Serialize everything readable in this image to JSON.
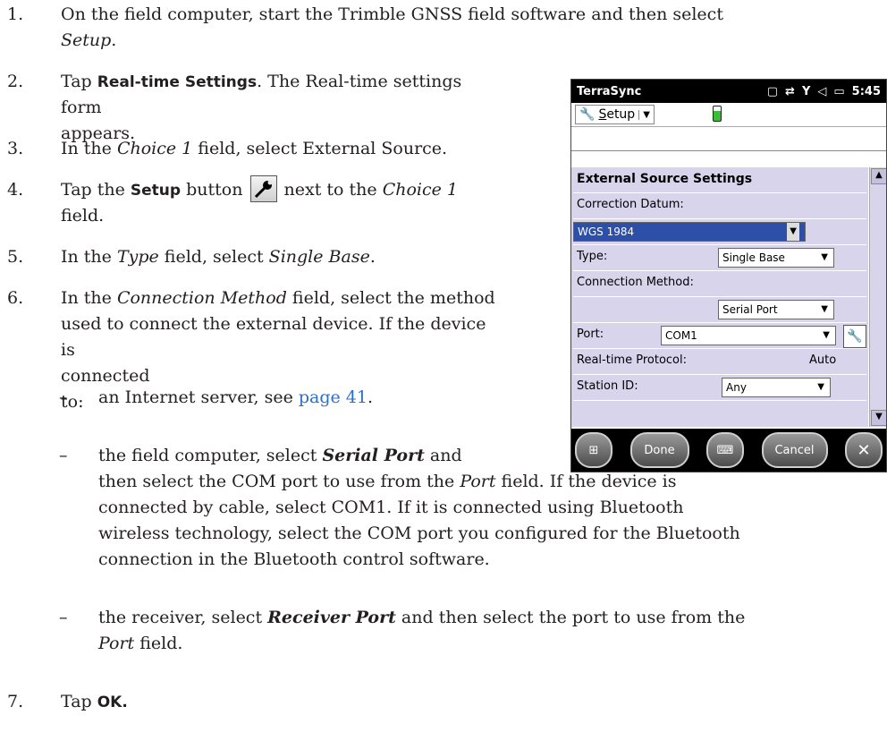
{
  "steps": [
    {
      "num": "1.",
      "pre": "On the field computer, start the Trimble GNSS field software and then select ",
      "em": "Setup",
      "post": "."
    },
    {
      "num": "2.",
      "pre": "Tap ",
      "ui": "Real-time Settings",
      "post": ". The Real-time settings",
      "line2": "form appears."
    },
    {
      "num": "3.",
      "pre": "In the ",
      "em": "Choice 1",
      "post": " field, select External Source."
    },
    {
      "num": "4.",
      "pre": "Tap the ",
      "ui": "Setup",
      "mid": " button ",
      "post": " next to the ",
      "em": "Choice 1",
      "line2": "field."
    },
    {
      "num": "5.",
      "pre": "In the ",
      "em": "Type",
      "mid": " field, select ",
      "em2": "Single Base",
      "post": "."
    },
    {
      "num": "6.",
      "pre": "In the ",
      "em": "Connection Method",
      "post": " field, select the method",
      "line2": "used to connect the external device. If the device",
      "line3": "is connected to:"
    },
    {
      "num": "7.",
      "pre": "Tap ",
      "ui": "OK."
    }
  ],
  "subitems": [
    {
      "dash": "–",
      "pre": "an Internet server, see ",
      "link": "page 41",
      "post": "."
    },
    {
      "dash": "–",
      "pre": "the field computer, select ",
      "bi": "Serial Port",
      "post": " and",
      "l2": "then select the COM port to use from the ",
      "l2em": "Port",
      "l2post": " field. If the device is",
      "l3": "connected by cable, select COM1. If it is connected using Bluetooth",
      "l4": "wireless technology, select the COM port you configured for the Bluetooth",
      "l5": "connection in the Bluetooth control software."
    },
    {
      "dash": "–",
      "pre": "the receiver, select ",
      "bi": "Receiver Port",
      "post": " and then select the port to use from the",
      "l2em": "Port",
      "l2post": " field."
    }
  ],
  "device": {
    "app": "TerraSync",
    "time": "5:45",
    "menu_pre": "",
    "menu_accel": "S",
    "menu_rest": "etup",
    "section": "External Source Settings",
    "correction_datum_label": "Correction Datum:",
    "correction_datum_value": "WGS 1984",
    "type_label": "Type:",
    "type_value": "Single Base",
    "connection_label": "Connection Method:",
    "connection_value": "Serial Port",
    "port_label": "Port:",
    "port_value": "COM1",
    "protocol_label": "Real-time Protocol:",
    "protocol_value": "Auto",
    "station_label": "Station ID:",
    "station_value": "Any",
    "done": "Done",
    "cancel": "Cancel"
  }
}
